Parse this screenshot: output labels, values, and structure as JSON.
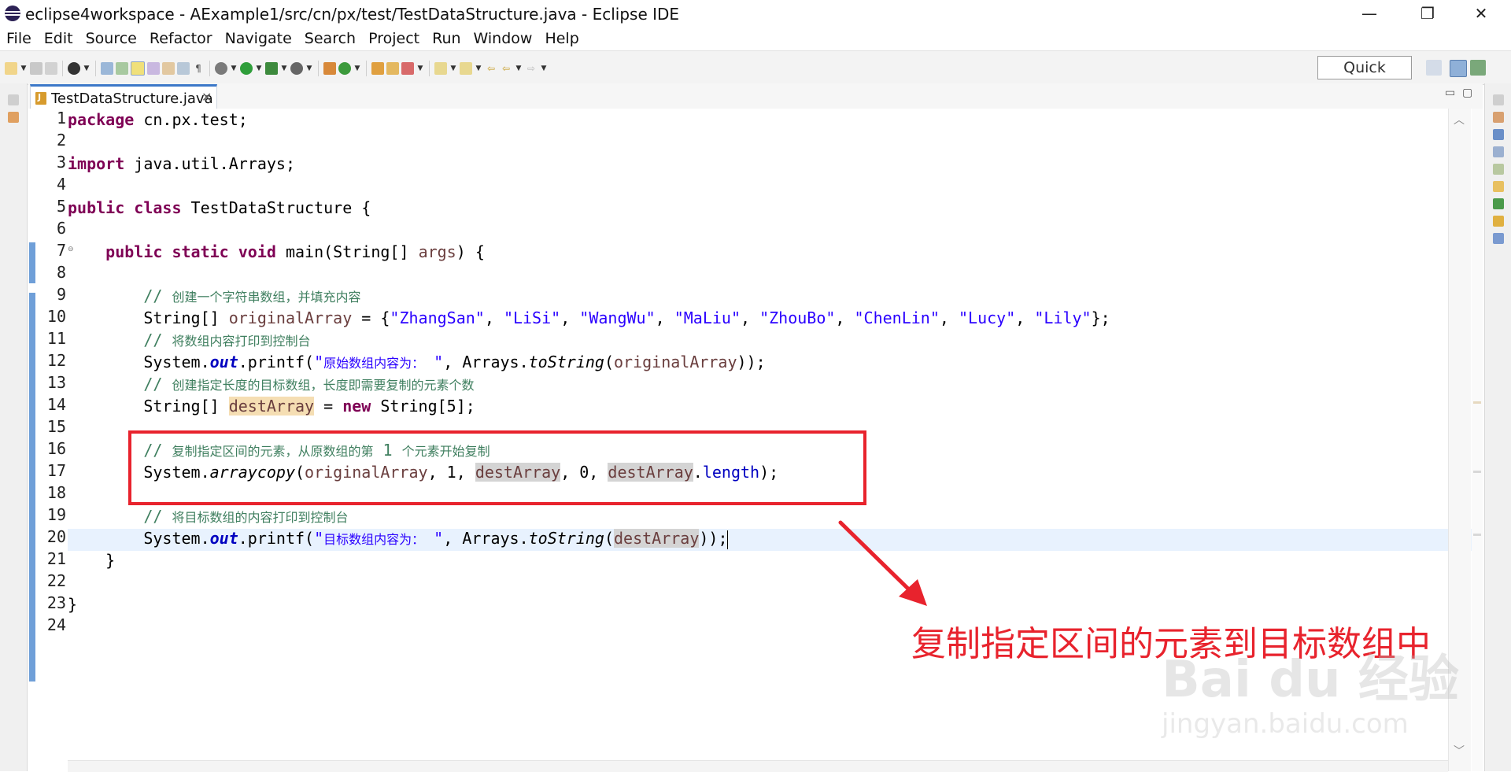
{
  "window": {
    "title": "eclipse4workspace - AExample1/src/cn/px/test/TestDataStructure.java - Eclipse IDE",
    "controls": {
      "minimize": "—",
      "maximize": "❐",
      "close": "✕"
    }
  },
  "menu": [
    "File",
    "Edit",
    "Source",
    "Refactor",
    "Navigate",
    "Search",
    "Project",
    "Run",
    "Window",
    "Help"
  ],
  "toolbar": {
    "quick_access": "Quick Access"
  },
  "editor": {
    "tab_label": "TestDataStructure.java",
    "tab_close": "✕",
    "minimize": "▭",
    "maximize": "▢",
    "line_numbers": [
      "1",
      "2",
      "3",
      "4",
      "5",
      "6",
      "7",
      "8",
      "9",
      "10",
      "11",
      "12",
      "13",
      "14",
      "15",
      "16",
      "17",
      "18",
      "19",
      "20",
      "21",
      "22",
      "23",
      "24"
    ],
    "fold_marker": "⊖",
    "code": {
      "l1_kw": "package",
      "l1_rest": " cn.px.test;",
      "l3_kw": "import",
      "l3_rest": " java.util.Arrays;",
      "l5_kw1": "public",
      "l5_kw2": "class",
      "l5_rest": " TestDataStructure {",
      "l7_kw1": "public",
      "l7_kw2": "static",
      "l7_kw3": "void",
      "l7_a": " main(String[] ",
      "l7_var": "args",
      "l7_b": ") {",
      "l9_slash": "// ",
      "l9_text": "创建一个字符串数组，并填充内容",
      "l10_a": "String[] ",
      "l10_var": "originalArray",
      "l10_b": " = {",
      "l10_strings": [
        "\"ZhangSan\"",
        "\"LiSi\"",
        "\"WangWu\"",
        "\"MaLiu\"",
        "\"ZhouBo\"",
        "\"ChenLin\"",
        "\"Lucy\"",
        "\"Lily\""
      ],
      "l10_sep": ", ",
      "l10_end": "};",
      "l11_slash": "// ",
      "l11_text": "将数组内容打印到控制台",
      "l12_a": "System.",
      "l12_field": "out",
      "l12_b": ".printf(",
      "l12_q1": "\"",
      "l12_cjk": "原始数组内容为：",
      "l12_q2": " \"",
      "l12_c": ", Arrays.",
      "l12_static": "toString",
      "l12_d": "(",
      "l12_var": "originalArray",
      "l12_e": "));",
      "l13_slash": "// ",
      "l13_text": "创建指定长度的目标数组，长度即需要复制的元素个数",
      "l14_a": "String[] ",
      "l14_var": "destArray",
      "l14_b": " = ",
      "l14_kw": "new",
      "l14_c": " String[5];",
      "l16_slash": "// ",
      "l16_text1": "复制指定区间的元素，从原数组的第",
      "l16_num": " 1 ",
      "l16_text2": "个元素开始复制",
      "l17_a": "System.",
      "l17_static": "arraycopy",
      "l17_b": "(",
      "l17_var1": "originalArray",
      "l17_c": ", 1, ",
      "l17_var2": "destArray",
      "l17_d": ", 0, ",
      "l17_var3": "destArray",
      "l17_e": ".",
      "l17_fld": "length",
      "l17_f": ");",
      "l19_slash": "// ",
      "l19_text": "将目标数组的内容打印到控制台",
      "l20_a": "System.",
      "l20_field": "out",
      "l20_b": ".printf(",
      "l20_q1": "\"",
      "l20_cjk": "目标数组内容为：",
      "l20_q2": " \"",
      "l20_c": ", Arrays.",
      "l20_static": "toString",
      "l20_d": "(",
      "l20_var": "destArray",
      "l20_e": "));",
      "l21": "}",
      "l23": "}"
    }
  },
  "annotation": {
    "text": "复制指定区间的元素到目标数组中",
    "color": "#e8232d"
  },
  "watermark": {
    "main": "Bai du 经验",
    "sub": "jingyan.baidu.com"
  },
  "colors": {
    "keyword": "#7f0055",
    "string": "#2a00ff",
    "comment": "#3f7f5f",
    "field": "#0000c0",
    "variable": "#6a3e3e",
    "highlight_box": "#e8232d"
  }
}
